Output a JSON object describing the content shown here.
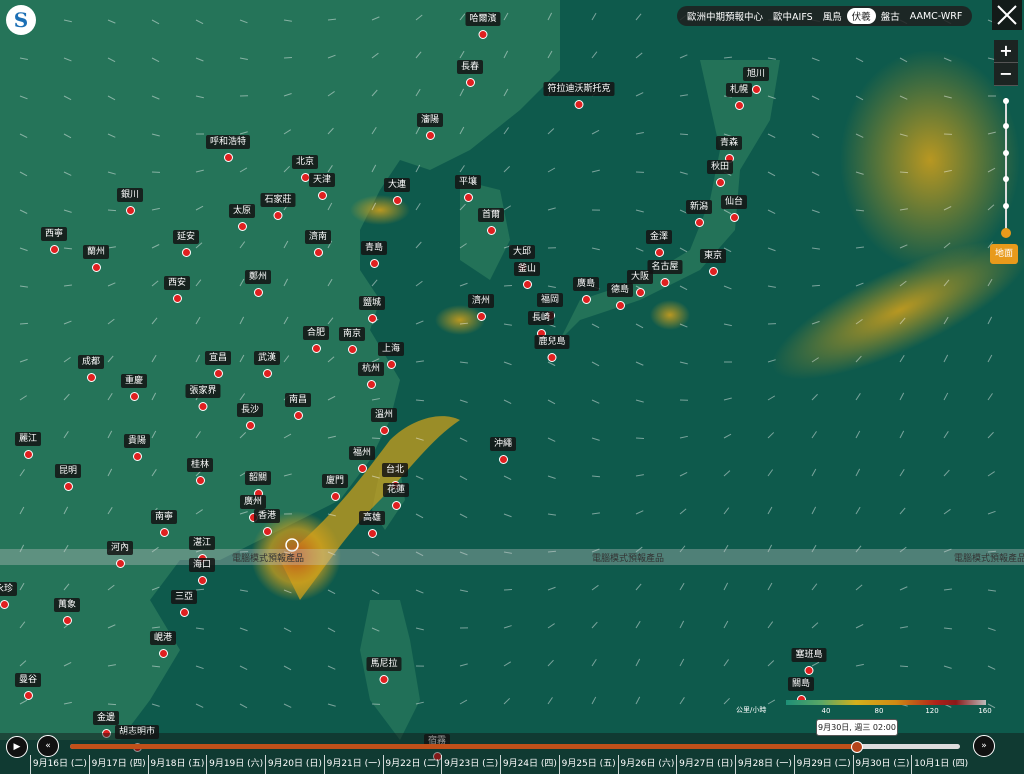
{
  "model_tabs": [
    "歐洲中期預報中心",
    "歐中AIFS",
    "風鳥",
    "伏羲",
    "盤古",
    "AAMC-WRF"
  ],
  "active_tab_index": 3,
  "banner_text": "電腦模式預報產品",
  "zoom": {
    "plus": "+",
    "minus": "−",
    "layer_button": "地面"
  },
  "legend": {
    "unit": "公里/小時",
    "ticks": [
      "40",
      "80",
      "120",
      "160"
    ]
  },
  "current_time": "9月30日, 週三 02:00",
  "timeline_progress": 0.883,
  "days": [
    "9月16日 (二)",
    "9月17日 (四)",
    "9月18日 (五)",
    "9月19日 (六)",
    "9月20日 (日)",
    "9月21日 (一)",
    "9月22日 (二)",
    "9月23日 (三)",
    "9月24日 (四)",
    "9月25日 (五)",
    "9月26日 (六)",
    "9月27日 (日)",
    "9月28日 (一)",
    "9月29日 (二)",
    "9月30日 (三)",
    "10月1日 (四)"
  ],
  "colors": {
    "ocean": "#0e5a4c",
    "land": "#2a7a5e",
    "storm": "#d6a21a",
    "storm_core": "#c0501a",
    "accent": "#e89a1b",
    "city_dot": "#e02020"
  },
  "cities": [
    "哈爾濱",
    "長春",
    "符拉迪沃斯托克",
    "旭川",
    "札幌",
    "呼和浩特",
    "瀋陽",
    "北京",
    "天津",
    "青森",
    "秋田",
    "銀川",
    "石家莊",
    "大連",
    "平壤",
    "仙台",
    "新潟",
    "太原",
    "首爾",
    "西寧",
    "延安",
    "濟南",
    "金澤",
    "蘭州",
    "青島",
    "大邱",
    "名古屋",
    "東京",
    "釜山",
    "西安",
    "鄭州",
    "廣島",
    "大阪",
    "福岡",
    "德島",
    "鹽城",
    "濟州",
    "長崎",
    "合肥",
    "南京",
    "鹿兒島",
    "上海",
    "成都",
    "宜昌",
    "武漢",
    "杭州",
    "重慶",
    "張家界",
    "南昌",
    "長沙",
    "溫州",
    "麗江",
    "貴陽",
    "沖繩",
    "福州",
    "昆明",
    "桂林",
    "台北",
    "韶關",
    "廈門",
    "花蓮",
    "廣州",
    "南寧",
    "香港",
    "高雄",
    "河內",
    "湛江",
    "海口",
    "萬象",
    "三亞",
    "峴港",
    "馬尼拉",
    "塞班島",
    "曼谷",
    "關島",
    "金邊",
    "胡志明市",
    "宿霧",
    "永珍"
  ]
}
